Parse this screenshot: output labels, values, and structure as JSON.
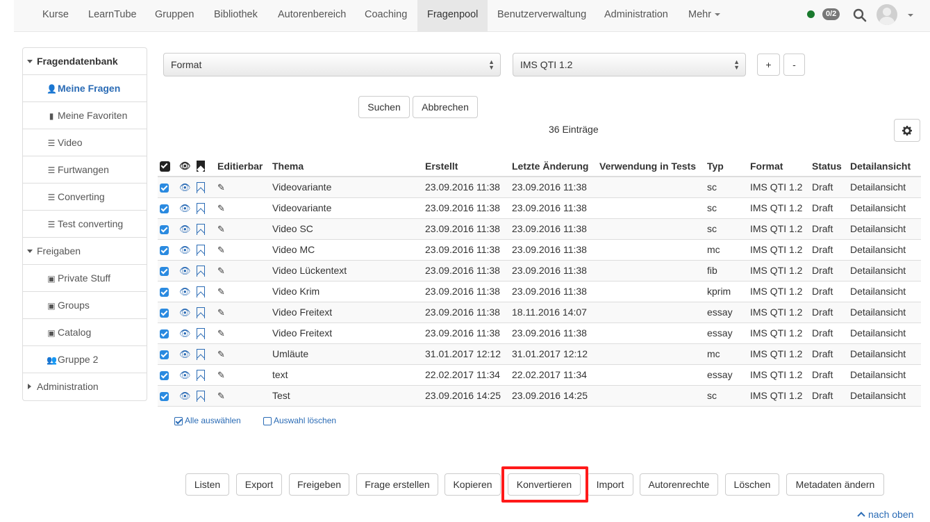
{
  "nav": {
    "items": [
      "Kurse",
      "LearnTube",
      "Gruppen",
      "Bibliothek",
      "Autorenbereich",
      "Coaching",
      "Fragenpool",
      "Benutzerverwaltung",
      "Administration"
    ],
    "more_label": "Mehr",
    "active": "Fragenpool",
    "badge": "0/2",
    "status_color": "#1a7a2e"
  },
  "sidebar": {
    "items": [
      {
        "label": "Fragendatenbank",
        "kind": "group",
        "icon": "triangle-down-icon"
      },
      {
        "label": "Meine Fragen",
        "kind": "sub",
        "icon": "user-icon",
        "active": true
      },
      {
        "label": "Meine Favoriten",
        "kind": "sub",
        "icon": "bookmark-icon"
      },
      {
        "label": "Video",
        "kind": "sub",
        "icon": "list-icon"
      },
      {
        "label": "Furtwangen",
        "kind": "sub",
        "icon": "list-icon"
      },
      {
        "label": "Converting",
        "kind": "sub",
        "icon": "list-icon"
      },
      {
        "label": "Test converting",
        "kind": "sub",
        "icon": "list-icon"
      },
      {
        "label": "Freigaben",
        "kind": "group",
        "icon": "triangle-down-icon"
      },
      {
        "label": "Private Stuff",
        "kind": "sub",
        "icon": "share-icon"
      },
      {
        "label": "Groups",
        "kind": "sub",
        "icon": "share-icon"
      },
      {
        "label": "Catalog",
        "kind": "sub",
        "icon": "share-icon"
      },
      {
        "label": "Gruppe 2",
        "kind": "sub",
        "icon": "users-icon"
      },
      {
        "label": "Administration",
        "kind": "group",
        "icon": "triangle-right-icon"
      }
    ]
  },
  "filter": {
    "field_value": "Format",
    "value_value": "IMS QTI 1.2",
    "add_label": "+",
    "remove_label": "-",
    "search_label": "Suchen",
    "cancel_label": "Abbrechen"
  },
  "results": {
    "count_text": "36 Einträge"
  },
  "table": {
    "headers": [
      "Editierbar",
      "Thema",
      "Erstellt",
      "Letzte Änderung",
      "Verwendung in Tests",
      "Typ",
      "Format",
      "Status",
      "Detailansicht"
    ],
    "rows": [
      {
        "thema": "Videovariante",
        "erstellt": "23.09.2016 11:38",
        "geaendert": "23.09.2016 11:38",
        "verwendung": "",
        "typ": "sc",
        "format": "IMS QTI 1.2",
        "status": "Draft",
        "detail": "Detailansicht"
      },
      {
        "thema": "Videovariante",
        "erstellt": "23.09.2016 11:38",
        "geaendert": "23.09.2016 11:38",
        "verwendung": "",
        "typ": "sc",
        "format": "IMS QTI 1.2",
        "status": "Draft",
        "detail": "Detailansicht"
      },
      {
        "thema": "Video SC",
        "erstellt": "23.09.2016 11:38",
        "geaendert": "23.09.2016 11:38",
        "verwendung": "",
        "typ": "sc",
        "format": "IMS QTI 1.2",
        "status": "Draft",
        "detail": "Detailansicht"
      },
      {
        "thema": "Video MC",
        "erstellt": "23.09.2016 11:38",
        "geaendert": "23.09.2016 11:38",
        "verwendung": "",
        "typ": "mc",
        "format": "IMS QTI 1.2",
        "status": "Draft",
        "detail": "Detailansicht"
      },
      {
        "thema": "Video Lückentext",
        "erstellt": "23.09.2016 11:38",
        "geaendert": "23.09.2016 11:38",
        "verwendung": "",
        "typ": "fib",
        "format": "IMS QTI 1.2",
        "status": "Draft",
        "detail": "Detailansicht"
      },
      {
        "thema": "Video Krim",
        "erstellt": "23.09.2016 11:38",
        "geaendert": "23.09.2016 11:38",
        "verwendung": "",
        "typ": "kprim",
        "format": "IMS QTI 1.2",
        "status": "Draft",
        "detail": "Detailansicht"
      },
      {
        "thema": "Video Freitext",
        "erstellt": "23.09.2016 11:38",
        "geaendert": "18.11.2016 14:07",
        "verwendung": "",
        "typ": "essay",
        "format": "IMS QTI 1.2",
        "status": "Draft",
        "detail": "Detailansicht"
      },
      {
        "thema": "Video Freitext",
        "erstellt": "23.09.2016 11:38",
        "geaendert": "23.09.2016 11:38",
        "verwendung": "",
        "typ": "essay",
        "format": "IMS QTI 1.2",
        "status": "Draft",
        "detail": "Detailansicht"
      },
      {
        "thema": "Umläute",
        "erstellt": "31.01.2017 12:12",
        "geaendert": "31.01.2017 12:12",
        "verwendung": "",
        "typ": "mc",
        "format": "IMS QTI 1.2",
        "status": "Draft",
        "detail": "Detailansicht"
      },
      {
        "thema": "text",
        "erstellt": "22.02.2017 11:34",
        "geaendert": "22.02.2017 11:34",
        "verwendung": "",
        "typ": "essay",
        "format": "IMS QTI 1.2",
        "status": "Draft",
        "detail": "Detailansicht"
      },
      {
        "thema": "Test",
        "erstellt": "23.09.2016 14:25",
        "geaendert": "23.09.2016 14:25",
        "verwendung": "",
        "typ": "sc",
        "format": "IMS QTI 1.2",
        "status": "Draft",
        "detail": "Detailansicht"
      }
    ]
  },
  "selection": {
    "select_all_label": "Alle auswählen",
    "clear_label": "Auswahl löschen"
  },
  "actions": [
    "Listen",
    "Export",
    "Freigeben",
    "Frage erstellen",
    "Kopieren",
    "Konvertieren",
    "Import",
    "Autorenrechte",
    "Löschen",
    "Metadaten ändern"
  ],
  "highlighted_action": "Konvertieren",
  "highlight_color": "#ff1a1a",
  "footer": {
    "top_link": "nach oben"
  }
}
